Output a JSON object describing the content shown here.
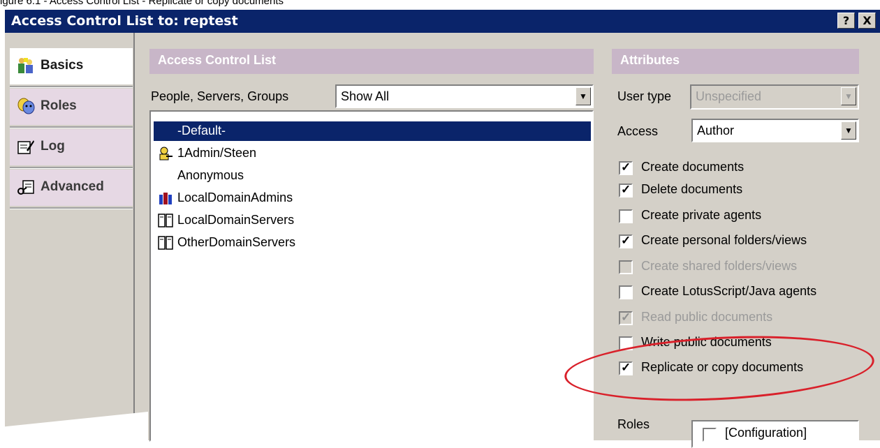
{
  "caption": "igure 6.1 - Access Control List - Replicate or copy documents",
  "window": {
    "title": "Access Control List to: reptest",
    "help_label": "?",
    "close_label": "X"
  },
  "sidebar": {
    "tabs": [
      {
        "label": "Basics",
        "icon": "people-icon",
        "active": true
      },
      {
        "label": "Roles",
        "icon": "masks-icon",
        "active": false
      },
      {
        "label": "Log",
        "icon": "log-icon",
        "active": false
      },
      {
        "label": "Advanced",
        "icon": "keys-icon",
        "active": false
      }
    ]
  },
  "acl": {
    "header": "Access Control List",
    "filter_label": "People, Servers, Groups",
    "filter_value": "Show All",
    "entries": [
      {
        "name": "-Default-",
        "icon": "",
        "selected": true
      },
      {
        "name": "1Admin/Steen",
        "icon": "person-key-icon",
        "selected": false
      },
      {
        "name": "Anonymous",
        "icon": "",
        "selected": false
      },
      {
        "name": "LocalDomainAdmins",
        "icon": "group-icon",
        "selected": false
      },
      {
        "name": "LocalDomainServers",
        "icon": "server-group-icon",
        "selected": false
      },
      {
        "name": "OtherDomainServers",
        "icon": "server-group-icon",
        "selected": false
      }
    ]
  },
  "attributes": {
    "header": "Attributes",
    "user_type_label": "User type",
    "user_type_value": "Unspecified",
    "access_label": "Access",
    "access_value": "Author",
    "options": [
      {
        "label": "Create documents",
        "checked": true,
        "enabled": true
      },
      {
        "label": "Delete documents",
        "checked": true,
        "enabled": true
      },
      {
        "label": "Create private agents",
        "checked": false,
        "enabled": true
      },
      {
        "label": "Create personal folders/views",
        "checked": true,
        "enabled": true
      },
      {
        "label": "Create shared folders/views",
        "checked": false,
        "enabled": false
      },
      {
        "label": "Create LotusScript/Java agents",
        "checked": false,
        "enabled": true
      },
      {
        "label": "Read public documents",
        "checked": true,
        "enabled": false
      },
      {
        "label": "Write public documents",
        "checked": false,
        "enabled": true
      },
      {
        "label": "Replicate or copy documents",
        "checked": true,
        "enabled": true
      }
    ],
    "roles_label": "Roles",
    "roles": [
      {
        "label": "[Configuration]",
        "checked": false
      }
    ]
  },
  "annotation_color": "#d9202a",
  "selection_color": "#0a246a",
  "header_color": "#c8b6c8"
}
